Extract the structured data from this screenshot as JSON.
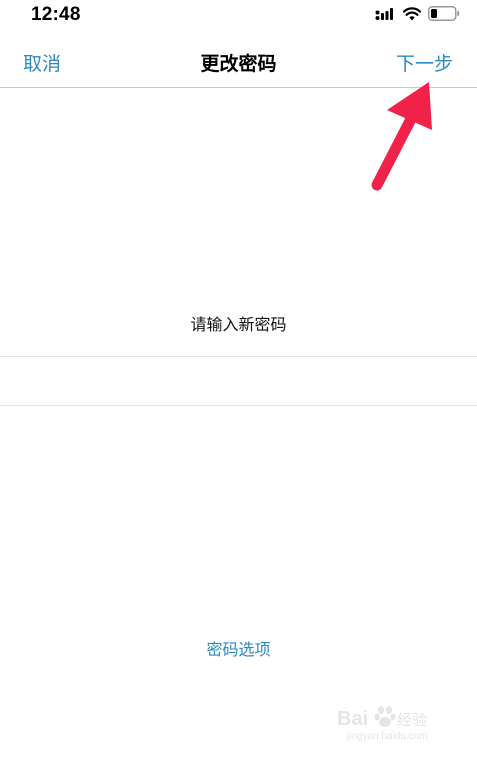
{
  "status_bar": {
    "time": "12:48",
    "icons": [
      "cellular-signal-icon",
      "wifi-icon",
      "battery-icon"
    ]
  },
  "nav": {
    "cancel_label": "取消",
    "title": "更改密码",
    "next_label": "下一步"
  },
  "form": {
    "prompt": "请输入新密码",
    "password_value": "",
    "options_label": "密码选项"
  },
  "watermark": {
    "brand": "Bai du 经验",
    "url": "jingyan.baidu.com"
  },
  "colors": {
    "accent": "#2b89c3",
    "annotation_arrow": "#f0224a",
    "divider": "#c8c7cc"
  }
}
